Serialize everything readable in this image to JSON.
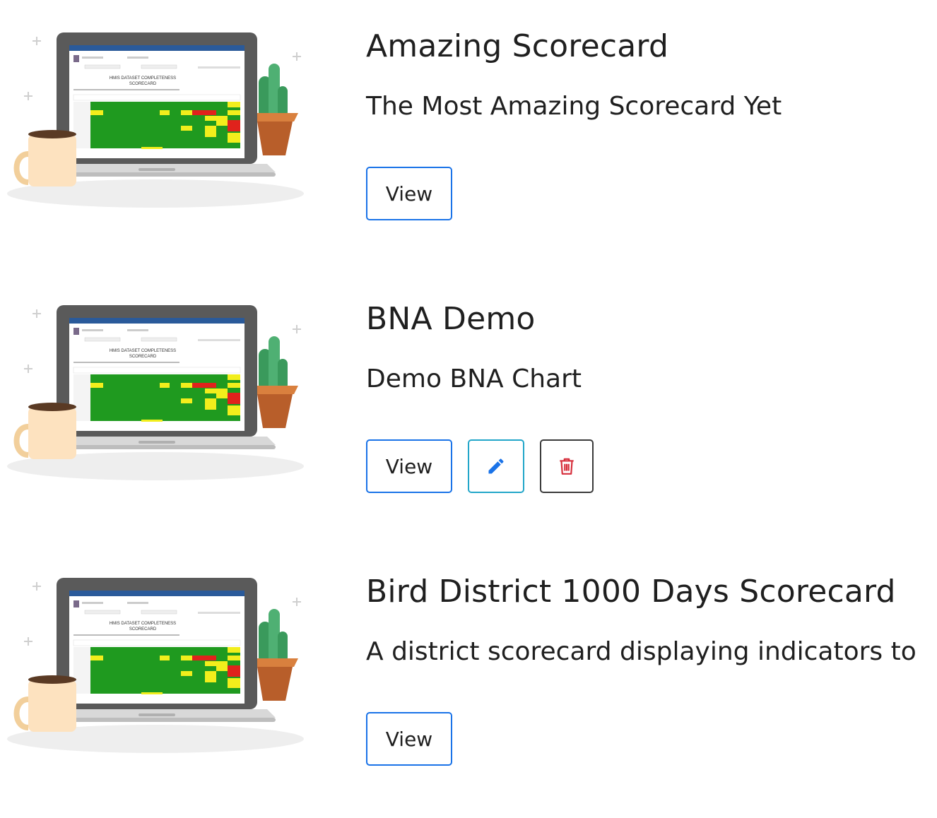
{
  "scorecards": [
    {
      "title": "Amazing Scorecard",
      "description": "The Most Amazing Scorecard Yet",
      "view_label": "View"
    },
    {
      "title": "BNA Demo",
      "description": "Demo BNA Chart",
      "view_label": "View"
    },
    {
      "title": "Bird District 1000 Days Scorecard",
      "description": "A district scorecard displaying indicators to",
      "view_label": "View"
    }
  ],
  "thumbnail": {
    "heading_line1": "HMIS DATASET COMPLETENESS",
    "heading_line2": "SCORECARD"
  },
  "icons": {
    "edit": "pencil-icon",
    "delete": "trash-icon"
  },
  "colors": {
    "view_border": "#1a73e8",
    "edit_border": "#22a6c9",
    "edit_icon": "#1a73e8",
    "delete_icon": "#d62d3a",
    "grid_green": "#1f9a1f",
    "grid_yellow": "#f2ee1c",
    "grid_red": "#e0221c"
  }
}
